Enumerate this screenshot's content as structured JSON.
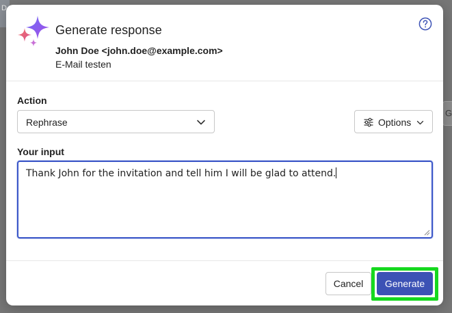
{
  "background": {
    "left_hint": "D",
    "right_hint": "Ge"
  },
  "dialog": {
    "title": "Generate response",
    "sender": "John Doe <john.doe@example.com>",
    "subject": "E-Mail testen",
    "help_icon": "question-circle-icon",
    "action_label": "Action",
    "action_selected": "Rephrase",
    "options_label": "Options",
    "input_label": "Your input",
    "input_value": "Thank John for the invitation and tell him I will be glad to attend.",
    "cancel_label": "Cancel",
    "generate_label": "Generate"
  },
  "colors": {
    "primary": "#3c52b5",
    "highlight": "#16d81f",
    "sparkle_purple": "#7b5cf0",
    "sparkle_pink": "#e45a8f"
  }
}
